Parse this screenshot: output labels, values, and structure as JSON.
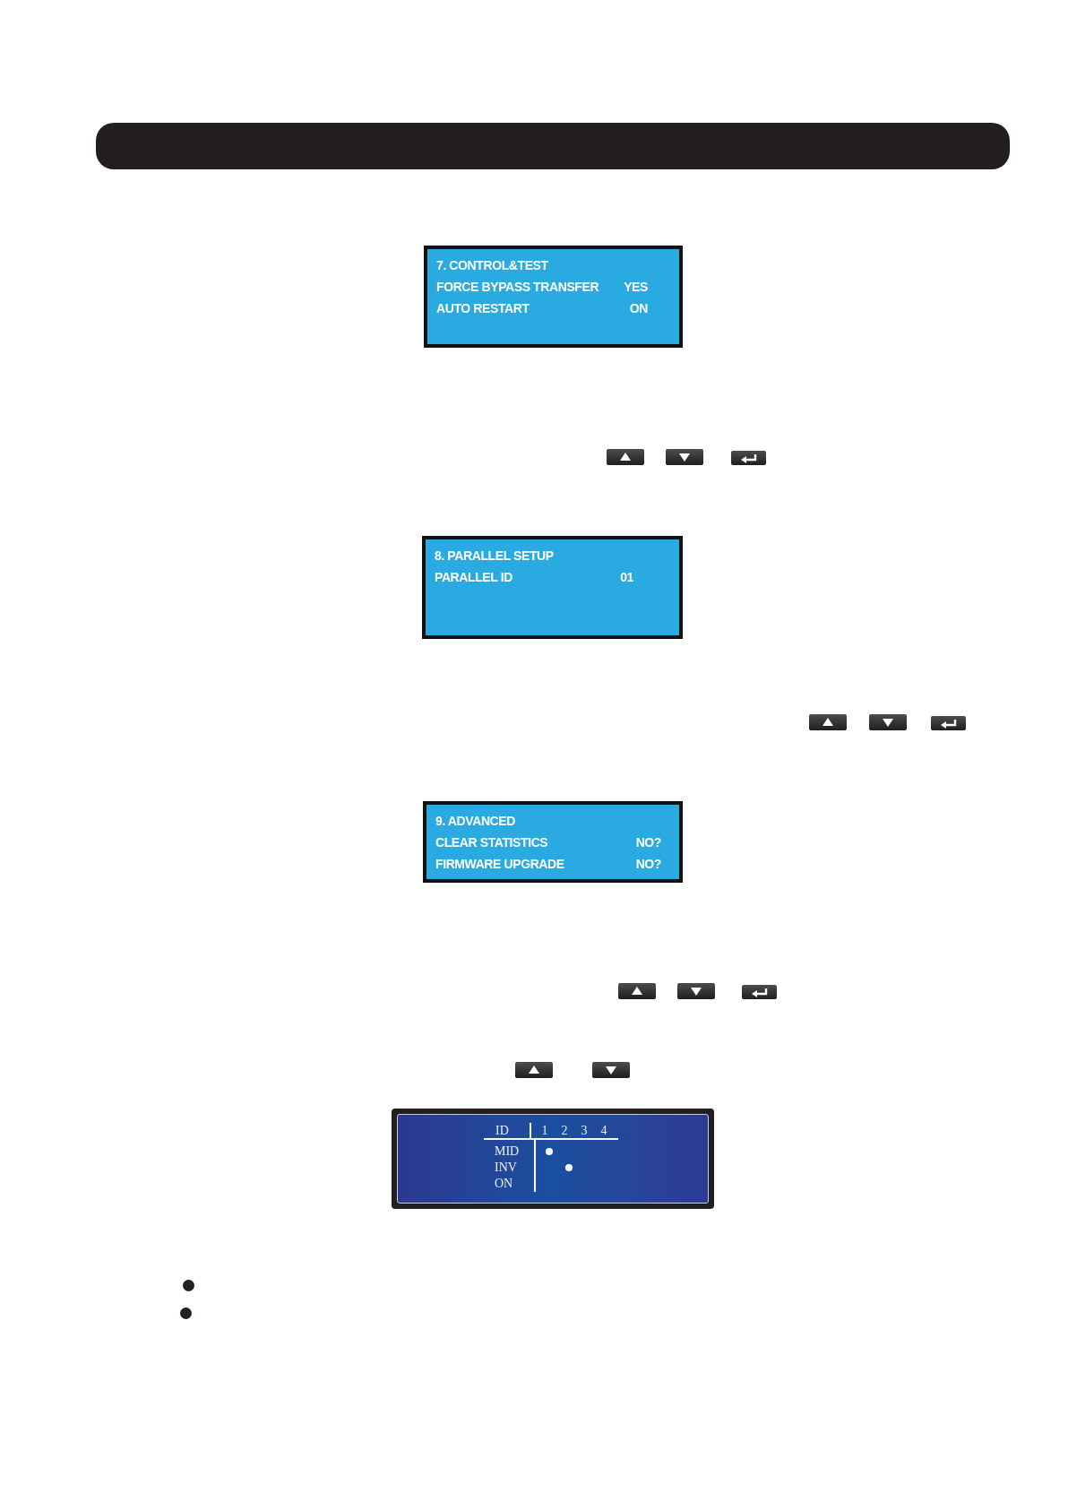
{
  "lcd_screens": [
    {
      "title": "7. CONTROL&TEST",
      "rows": [
        {
          "label": "FORCE BYPASS TRANSFER",
          "value": "YES"
        },
        {
          "label": "AUTO RESTART",
          "value": "ON"
        }
      ]
    },
    {
      "title": "8. PARALLEL SETUP",
      "rows": [
        {
          "label": "PARALLEL ID",
          "value": "01"
        }
      ]
    },
    {
      "title": "9. ADVANCED",
      "rows": [
        {
          "label": "CLEAR STATISTICS",
          "value": "NO?"
        },
        {
          "label": "FIRMWARE UPGRADE",
          "value": "NO?"
        }
      ]
    }
  ],
  "key_rows": [
    {
      "keys": [
        {
          "kind": "up"
        },
        {
          "kind": "down"
        },
        {
          "kind": "enter"
        }
      ]
    },
    {
      "keys": [
        {
          "kind": "up"
        },
        {
          "kind": "down"
        },
        {
          "kind": "enter"
        }
      ]
    },
    {
      "keys": [
        {
          "kind": "up"
        },
        {
          "kind": "down"
        },
        {
          "kind": "enter"
        }
      ]
    },
    {
      "keys": [
        {
          "kind": "up"
        },
        {
          "kind": "down"
        }
      ]
    }
  ],
  "status_panel": {
    "header": "ID",
    "columns": [
      "1",
      "2",
      "3",
      "4"
    ],
    "rows": [
      {
        "label": "MID",
        "lit": [
          true,
          false,
          false,
          false
        ]
      },
      {
        "label": "INV",
        "lit": [
          false,
          true,
          false,
          false
        ]
      },
      {
        "label": "ON",
        "lit": [
          false,
          false,
          false,
          false
        ]
      }
    ]
  }
}
